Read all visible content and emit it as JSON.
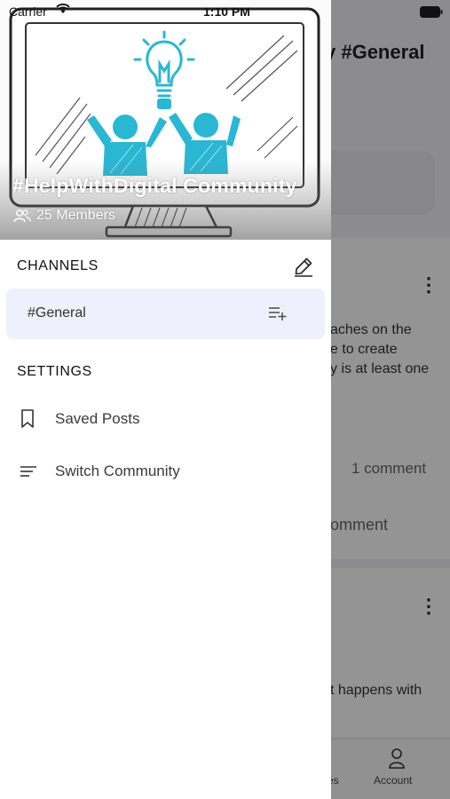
{
  "status_bar": {
    "carrier": "Carrier",
    "time": "1:10 PM"
  },
  "background": {
    "title_fragment": "y #General",
    "post_lines": [
      "aches on the",
      "e to create",
      "y is at least one"
    ],
    "comment_count": "1 comment",
    "comment_action": "omment",
    "post2_line": "t happens with",
    "tab_left_fragment": "es",
    "tab_account": "Account"
  },
  "drawer": {
    "community_name": "#HelpWithDigital Community",
    "members": "25 Members",
    "channels_title": "CHANNELS",
    "channels": [
      {
        "label": "#General"
      }
    ],
    "settings_title": "SETTINGS",
    "settings_items": [
      {
        "label": "Saved Posts",
        "icon": "bookmark-icon"
      },
      {
        "label": "Switch Community",
        "icon": "sort-lines-icon"
      }
    ]
  },
  "colors": {
    "accent_blue": "#29b7d3",
    "selected_row": "#eef0fb"
  }
}
